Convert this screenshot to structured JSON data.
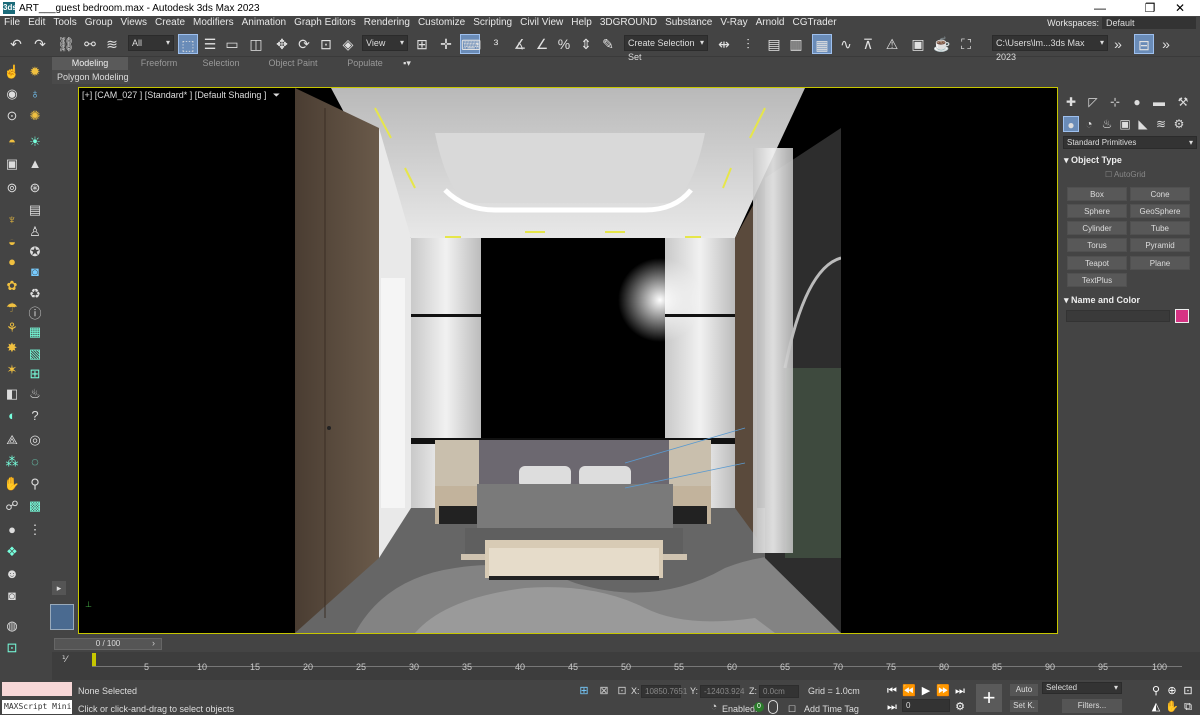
{
  "window": {
    "title": "ART___guest bedroom.max - Autodesk 3ds Max 2023",
    "app_icon": "3ds",
    "min": "—",
    "max": "❐",
    "close": "✕"
  },
  "menu": [
    "File",
    "Edit",
    "Tools",
    "Group",
    "Views",
    "Create",
    "Modifiers",
    "Animation",
    "Graph Editors",
    "Rendering",
    "Customize",
    "Scripting",
    "Civil View",
    "Help",
    "3DGROUND",
    "Substance",
    "V-Ray",
    "Arnold",
    "CGTrader"
  ],
  "workspaces": {
    "label": "Workspaces:",
    "value": "Default"
  },
  "toolbar": {
    "selection_filter": "All",
    "ref_coord": "View",
    "named_selection": "Create Selection Set",
    "project_path": "C:\\Users\\lm...3ds Max 2023"
  },
  "ribbon": {
    "tabs": [
      "Modeling",
      "Freeform",
      "Selection",
      "Object Paint",
      "Populate"
    ],
    "active": "Modeling",
    "subtitle": "Polygon Modeling"
  },
  "viewport": {
    "label": "[+] [CAM_027 ] [Standard* ] [Default Shading ]"
  },
  "command_panel": {
    "category": "Standard Primitives",
    "object_type_title": "Object Type",
    "autogrid": "AutoGrid",
    "buttons": [
      "Box",
      "Cone",
      "Sphere",
      "GeoSphere",
      "Cylinder",
      "Tube",
      "Torus",
      "Pyramid",
      "Teapot",
      "Plane",
      "TextPlus"
    ],
    "name_color_title": "Name and Color",
    "color": "#d63384"
  },
  "timeline": {
    "position": "0 / 100",
    "ticks": [
      "5",
      "10",
      "15",
      "20",
      "25",
      "30",
      "35",
      "40",
      "45",
      "50",
      "55",
      "60",
      "65",
      "70",
      "75",
      "80",
      "85",
      "90",
      "95",
      "100"
    ]
  },
  "status": {
    "maxscript": "MAXScript Mini",
    "selected": "None Selected",
    "prompt": "Click or click-and-drag to select objects",
    "x_label": "X:",
    "x_value": "10850.7651",
    "y_label": "Y:",
    "y_value": "-12403.924",
    "z_label": "Z:",
    "z_value": "0.0cm",
    "grid": "Grid = 1.0cm",
    "enabled": "Enabled:",
    "add_time_tag": "Add Time Tag",
    "auto": "Auto",
    "setk": "Set K.",
    "key_mode": "Selected",
    "filters": "Filters...",
    "frame": "0"
  }
}
